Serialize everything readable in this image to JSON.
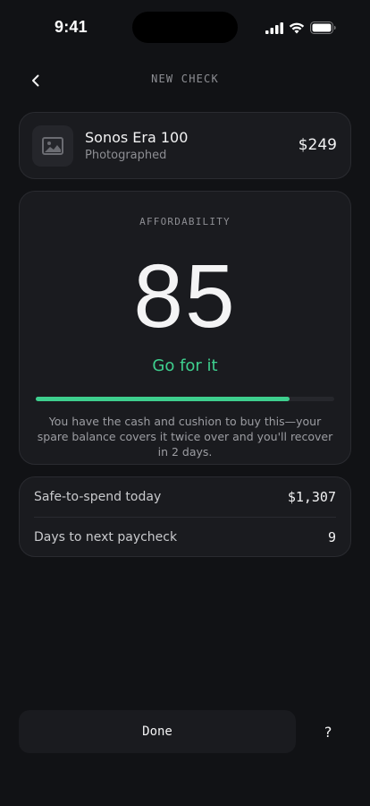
{
  "status_bar": {
    "time": "9:41",
    "icons": [
      "signal-icon",
      "wifi-icon",
      "battery-icon"
    ]
  },
  "header": {
    "back_icon": "chevron-left-icon",
    "title": "NEW CHECK"
  },
  "product": {
    "thumbnail_icon": "image-icon",
    "name": "Sonos Era 100",
    "status": "Photographed",
    "price": "$249"
  },
  "affordability": {
    "label": "AFFORDABILITY",
    "score": "85",
    "verdict": "Go for it",
    "progress_percent": 85,
    "description": "You have the cash and cushion to buy this—your spare balance covers it twice over and you'll recover in 2 days."
  },
  "stats": [
    {
      "label": "Safe-to-spend today",
      "value": "$1,307"
    },
    {
      "label": "Days to next paycheck",
      "value": "9"
    }
  ],
  "actions": {
    "done_label": "Done",
    "help_label": "?"
  },
  "colors": {
    "background": "#111215",
    "card": "#1a1b1f",
    "accent_green": "#3ecf8e",
    "muted_text": "#8d8e93"
  }
}
